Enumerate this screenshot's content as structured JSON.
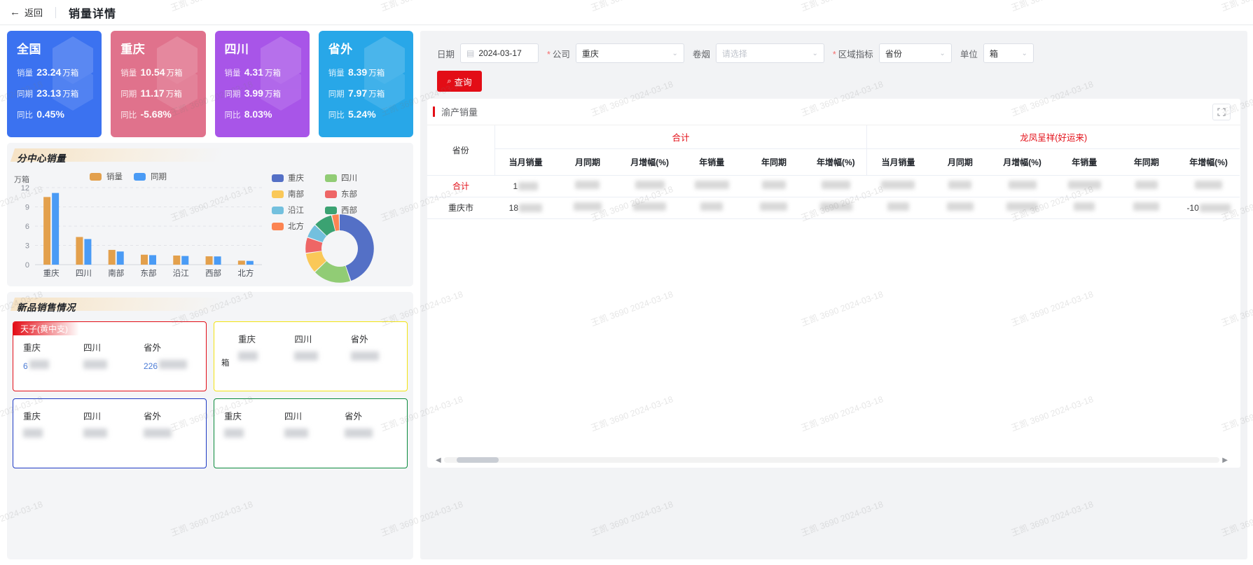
{
  "topbar": {
    "back_label": "返回",
    "back_icon": "arrow-left-icon",
    "title": "销量详情"
  },
  "kpi_cards": [
    {
      "name": "全国",
      "color": "#3b72f0",
      "sales_label": "销量",
      "sales_value": "23.24",
      "sales_unit": "万箱",
      "same_label": "同期",
      "same_value": "23.13",
      "same_unit": "万箱",
      "yoy_label": "同比",
      "yoy_value": "0.45%"
    },
    {
      "name": "重庆",
      "color": "#e0728c",
      "sales_label": "销量",
      "sales_value": "10.54",
      "sales_unit": "万箱",
      "same_label": "同期",
      "same_value": "11.17",
      "same_unit": "万箱",
      "yoy_label": "同比",
      "yoy_value": "-5.68%"
    },
    {
      "name": "四川",
      "color": "#a855e8",
      "sales_label": "销量",
      "sales_value": "4.31",
      "sales_unit": "万箱",
      "same_label": "同期",
      "same_value": "3.99",
      "same_unit": "万箱",
      "yoy_label": "同比",
      "yoy_value": "8.03%"
    },
    {
      "name": "省外",
      "color": "#28a7e8",
      "sales_label": "销量",
      "sales_value": "8.39",
      "sales_unit": "万箱",
      "same_label": "同期",
      "same_value": "7.97",
      "same_unit": "万箱",
      "yoy_label": "同比",
      "yoy_value": "5.24%"
    }
  ],
  "branch_section": {
    "title": "分中心销量"
  },
  "newproduct_section": {
    "title": "新品销售情况"
  },
  "newproduct_cards": [
    {
      "ribbon": "天子(黄中支)",
      "border": "#e30d16",
      "cols": [
        {
          "name": "重庆",
          "value": "6"
        },
        {
          "name": "四川",
          "value": ""
        },
        {
          "name": "省外",
          "value": "226"
        }
      ]
    },
    {
      "ribbon": "",
      "border": "#f2e313",
      "unit": "箱",
      "cols": [
        {
          "name": "重庆",
          "value": ""
        },
        {
          "name": "四川",
          "value": ""
        },
        {
          "name": "省外",
          "value": ""
        }
      ]
    },
    {
      "ribbon": "",
      "border": "#1d39c4",
      "cols": [
        {
          "name": "重庆",
          "value": ""
        },
        {
          "name": "四川",
          "value": ""
        },
        {
          "name": "省外",
          "value": ""
        }
      ]
    },
    {
      "ribbon": "",
      "border": "#0a8a3c",
      "cols": [
        {
          "name": "重庆",
          "value": ""
        },
        {
          "name": "四川",
          "value": ""
        },
        {
          "name": "省外",
          "value": ""
        }
      ]
    }
  ],
  "filters": {
    "date": {
      "label": "日期",
      "value": "2024-03-17",
      "icon": "calendar-icon",
      "required": false
    },
    "company": {
      "label": "公司",
      "value": "重庆",
      "required": true,
      "icon": "chevron-down-icon"
    },
    "cigarette": {
      "label": "卷烟",
      "value": "",
      "placeholder": "请选择",
      "required": false,
      "icon": "chevron-down-icon"
    },
    "region_metric": {
      "label": "区域指标",
      "value": "省份",
      "required": true,
      "icon": "chevron-down-icon"
    },
    "unit": {
      "label": "单位",
      "value": "箱",
      "required": false,
      "icon": "chevron-down-icon"
    },
    "search_button": {
      "label": "查询",
      "icon": "search-icon",
      "color": "#e30d16"
    }
  },
  "table_card": {
    "title": "渝产销量",
    "expand_icon": "expand-icon"
  },
  "chart_data": [
    {
      "type": "bar",
      "title": "分中心销量",
      "ylabel": "万箱",
      "categories": [
        "重庆",
        "四川",
        "南部",
        "东部",
        "沿江",
        "西部",
        "北方"
      ],
      "series": [
        {
          "name": "销量",
          "color": "#e5a köz",
          "values": [
            10.54,
            4.31,
            2.3,
            1.55,
            1.42,
            1.3,
            0.62
          ]
        },
        {
          "name": "同期",
          "color": "#4a9bf5",
          "values": [
            11.17,
            3.99,
            2.05,
            1.48,
            1.35,
            1.28,
            0.58
          ]
        }
      ],
      "yticks": [
        0,
        3,
        6,
        9,
        12
      ],
      "ylim": [
        0,
        12
      ],
      "grid": true,
      "legend_position": "top"
    },
    {
      "type": "pie",
      "subtype": "donut",
      "labels": [
        "重庆",
        "四川",
        "南部",
        "东部",
        "沿江",
        "西部",
        "北方"
      ],
      "colors": [
        "#5470c6",
        "#91cc75",
        "#fac858",
        "#ee6666",
        "#73c0de",
        "#3ba272",
        "#fc8452"
      ],
      "values": [
        45.0,
        18.2,
        9.8,
        7.6,
        6.8,
        9.0,
        3.6
      ],
      "legend_position": "top-left"
    }
  ],
  "data_table": {
    "row_header": "省份",
    "groups": [
      {
        "name": "合计",
        "columns": [
          "当月销量",
          "月同期",
          "月增幅(%)",
          "年销量",
          "年同期",
          "年增幅(%)"
        ]
      },
      {
        "name": "龙凤呈祥(好运来)",
        "columns": [
          "当月销量",
          "月同期",
          "月增幅(%)",
          "年销量",
          "年同期",
          "年增幅(%)"
        ]
      }
    ],
    "rows": [
      {
        "label": "合计",
        "highlight": true,
        "cells": [
          "1",
          "",
          "",
          "",
          "",
          "",
          "",
          "",
          "",
          "",
          "",
          ""
        ]
      },
      {
        "label": "重庆市",
        "highlight": false,
        "cells": [
          "18",
          "",
          "",
          "",
          "",
          "",
          "",
          "",
          "",
          "",
          "",
          "-10"
        ]
      }
    ]
  },
  "scrollbar": {
    "left_arrow": "◀",
    "right_arrow": "▶"
  },
  "watermark": {
    "text": "王凯 3690 2024-03-18"
  }
}
